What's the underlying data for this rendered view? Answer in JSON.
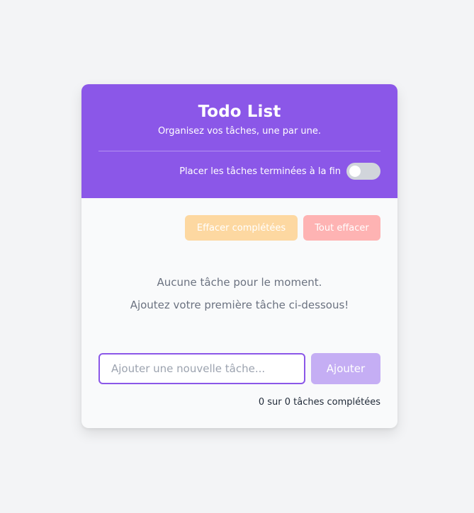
{
  "header": {
    "title": "Todo List",
    "subtitle": "Organisez vos tâches, une par une.",
    "toggle_label": "Placer les tâches terminées à la fin",
    "toggle_on": false
  },
  "actions": {
    "clear_completed_label": "Effacer complétées",
    "clear_all_label": "Tout effacer"
  },
  "empty_state": {
    "line1": "Aucune tâche pour le moment.",
    "line2": "Ajoutez votre première tâche ci-dessous!"
  },
  "add_task": {
    "value": "",
    "placeholder": "Ajouter une nouvelle tâche...",
    "button_label": "Ajouter"
  },
  "footer": {
    "counter_text": "0 sur 0 tâches complétées"
  },
  "colors": {
    "primary": "#8b57e8",
    "clear_completed": "#fdd8a1",
    "clear_all": "#feb3b3",
    "add_button": "#c5aef4",
    "page_bg": "#f3f4f6"
  }
}
